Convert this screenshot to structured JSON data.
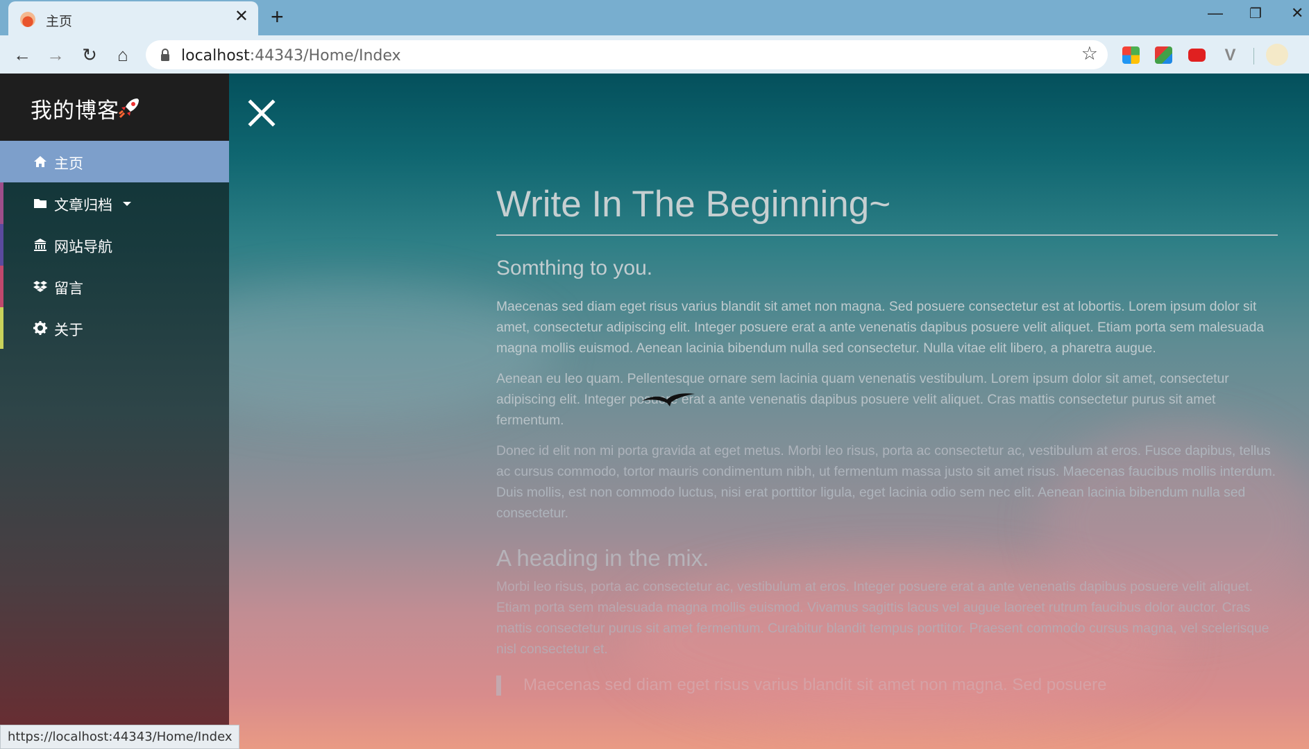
{
  "browser": {
    "tab_title": "主页",
    "url_host": "localhost",
    "url_rest": ":44343/Home/Index",
    "status_url": "https://localhost:44343/Home/Index"
  },
  "blog": {
    "brand": "我的博客",
    "nav": [
      {
        "label": "主页",
        "icon": "home-icon",
        "active": true
      },
      {
        "label": "文章归档",
        "icon": "folder-icon",
        "dropdown": true
      },
      {
        "label": "网站导航",
        "icon": "bank-icon"
      },
      {
        "label": "留言",
        "icon": "dropbox-icon"
      },
      {
        "label": "关于",
        "icon": "gear-icon"
      }
    ],
    "accent_colors": [
      "#7d9fcb",
      "#9e4e8a",
      "#5b4a9e",
      "#c0486d",
      "#c9d25b"
    ]
  },
  "article": {
    "title": "Write In The Beginning~",
    "subtitle": "Somthing to you.",
    "paragraphs": [
      "Maecenas sed diam eget risus varius blandit sit amet non magna. Sed posuere consectetur est at lobortis. Lorem ipsum dolor sit amet, consectetur adipiscing elit. Integer posuere erat a ante venenatis dapibus posuere velit aliquet. Etiam porta sem malesuada magna mollis euismod. Aenean lacinia bibendum nulla sed consectetur. Nulla vitae elit libero, a pharetra augue.",
      "Aenean eu leo quam. Pellentesque ornare sem lacinia quam venenatis vestibulum. Lorem ipsum dolor sit amet, consectetur adipiscing elit. Integer posuere erat a ante venenatis dapibus posuere velit aliquet. Cras mattis consectetur purus sit amet fermentum.",
      "Donec id elit non mi porta gravida at eget metus. Morbi leo risus, porta ac consectetur ac, vestibulum at eros. Fusce dapibus, tellus ac cursus commodo, tortor mauris condimentum nibh, ut fermentum massa justo sit amet risus. Maecenas faucibus mollis interdum. Duis mollis, est non commodo luctus, nisi erat porttitor ligula, eget lacinia odio sem nec elit. Aenean lacinia bibendum nulla sed consectetur."
    ],
    "heading2": "A heading in the mix.",
    "paragraph4": "Morbi leo risus, porta ac consectetur ac, vestibulum at eros. Integer posuere erat a ante venenatis dapibus posuere velit aliquet. Etiam porta sem malesuada magna mollis euismod. Vivamus sagittis lacus vel augue laoreet rutrum faucibus dolor auctor. Cras mattis consectetur purus sit amet fermentum. Curabitur blandit tempus porttitor. Praesent commodo cursus magna, vel scelerisque nisl consectetur et.",
    "quote": "Maecenas sed diam eget risus varius blandit sit amet non magna. Sed posuere"
  }
}
